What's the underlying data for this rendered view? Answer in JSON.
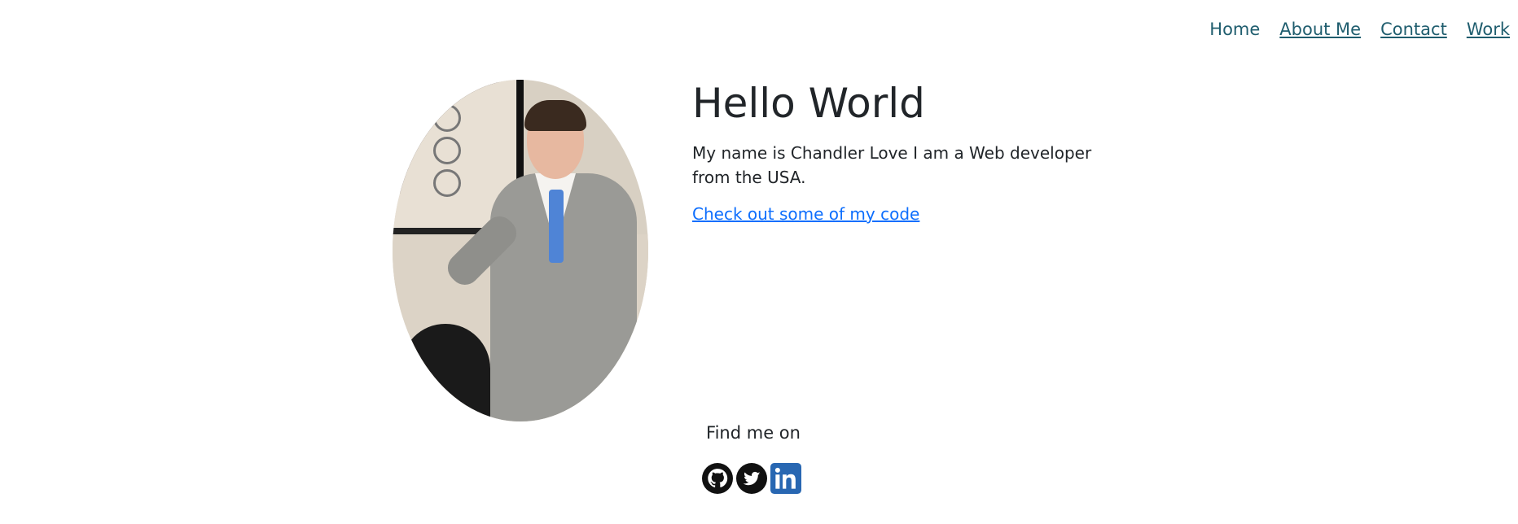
{
  "nav": {
    "items": [
      {
        "label": "Home"
      },
      {
        "label": "About Me"
      },
      {
        "label": "Contact"
      },
      {
        "label": "Work"
      }
    ]
  },
  "intro": {
    "heading": "Hello World",
    "description": "My name is Chandler Love I am a Web developer from the USA.",
    "code_link": "Check out some of my code"
  },
  "footer": {
    "find_me_label": "Find me on",
    "social": [
      {
        "name": "github-icon"
      },
      {
        "name": "twitter-icon"
      },
      {
        "name": "linkedin-icon"
      }
    ]
  },
  "colors": {
    "nav_link": "#1f5d6e",
    "link": "#0d6efd",
    "text": "#212529",
    "linkedin": "#2867b2"
  }
}
